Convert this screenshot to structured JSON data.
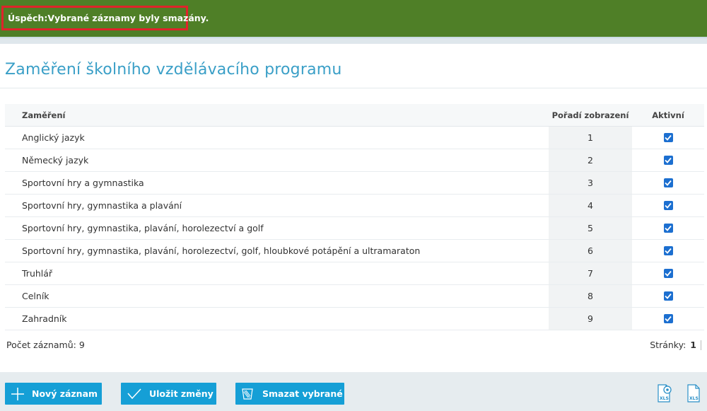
{
  "banner": {
    "label": "Úspěch:",
    "message": "Vybrané záznamy byly smazány.",
    "color": "#4f7f27",
    "highlight": "#e0232b"
  },
  "page": {
    "title": "Zaměření školního vzdělávacího programu"
  },
  "table": {
    "headers": {
      "name": "Zaměření",
      "order": "Pořadí zobrazení",
      "active": "Aktivní"
    },
    "rows": [
      {
        "name": "Anglický jazyk",
        "order": "1",
        "active": true
      },
      {
        "name": "Německý jazyk",
        "order": "2",
        "active": true
      },
      {
        "name": "Sportovní hry a gymnastika",
        "order": "3",
        "active": true
      },
      {
        "name": "Sportovní hry, gymnastika a plavání",
        "order": "4",
        "active": true
      },
      {
        "name": "Sportovní hry, gymnastika, plavání, horolezectví a golf",
        "order": "5",
        "active": true
      },
      {
        "name": "Sportovní hry, gymnastika, plavání, horolezectví, golf, hloubkové potápění a ultramaraton",
        "order": "6",
        "active": true
      },
      {
        "name": "Truhlář",
        "order": "7",
        "active": true
      },
      {
        "name": "Celník",
        "order": "8",
        "active": true
      },
      {
        "name": "Zahradník",
        "order": "9",
        "active": true
      }
    ]
  },
  "summary": {
    "count_label": "Počet záznamů: 9",
    "pages_label": "Stránky:",
    "current_page": "1"
  },
  "toolbar": {
    "new_label": "Nový záznam",
    "save_label": "Uložit změny",
    "delete_label": "Smazat vybrané",
    "accent": "#159fd6",
    "icons": [
      "plus-icon",
      "checkmark-icon",
      "trash-icon",
      "xls-settings-icon",
      "xls-export-icon"
    ]
  }
}
